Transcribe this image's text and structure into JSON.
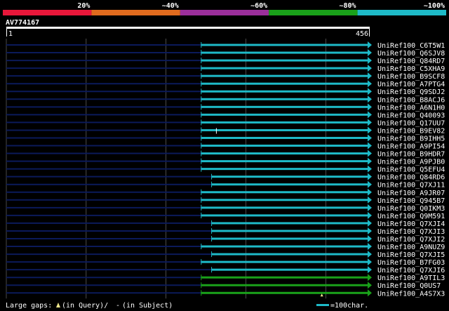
{
  "chart_data": {
    "type": "alignment",
    "query_name": "AV774167",
    "query_length": 456,
    "scale_start_label": "1",
    "scale_end_label": "456",
    "identity_scale": [
      {
        "label": "20%",
        "color": "#e8173a"
      },
      {
        "label": "~40%",
        "color": "#e06b1e"
      },
      {
        "label": "~60%",
        "color": "#9b2f9b"
      },
      {
        "label": "~80%",
        "color": "#1aa11a"
      },
      {
        "label": "~100%",
        "color": "#1ebac8"
      }
    ],
    "hits": [
      {
        "name": "UniRef100_C6T5W1",
        "start": 245,
        "end": 456,
        "color": "#1ebac8"
      },
      {
        "name": "UniRef100_Q6SJV8",
        "start": 245,
        "end": 456,
        "color": "#1ebac8"
      },
      {
        "name": "UniRef100_Q84RD7",
        "start": 245,
        "end": 456,
        "color": "#1ebac8"
      },
      {
        "name": "UniRef100_C5XHA9",
        "start": 245,
        "end": 456,
        "color": "#1ebac8"
      },
      {
        "name": "UniRef100_B9SCF8",
        "start": 245,
        "end": 456,
        "color": "#1ebac8"
      },
      {
        "name": "UniRef100_A7PTG4",
        "start": 245,
        "end": 456,
        "color": "#1ebac8"
      },
      {
        "name": "UniRef100_Q9SDJ2",
        "start": 245,
        "end": 456,
        "color": "#1ebac8"
      },
      {
        "name": "UniRef100_B8ACJ6",
        "start": 245,
        "end": 456,
        "color": "#1ebac8"
      },
      {
        "name": "UniRef100_A6N1H0",
        "start": 245,
        "end": 456,
        "color": "#1ebac8"
      },
      {
        "name": "UniRef100_Q40093",
        "start": 245,
        "end": 456,
        "color": "#1ebac8"
      },
      {
        "name": "UniRef100_Q17UU7",
        "start": 245,
        "end": 456,
        "color": "#1ebac8"
      },
      {
        "name": "UniRef100_B9EV82",
        "start": 245,
        "end": 456,
        "color": "#1ebac8",
        "subject_gap_at": 264
      },
      {
        "name": "UniRef100_B9IHH5",
        "start": 245,
        "end": 456,
        "color": "#1ebac8"
      },
      {
        "name": "UniRef100_A9PI54",
        "start": 245,
        "end": 456,
        "color": "#1ebac8"
      },
      {
        "name": "UniRef100_B9HDR7",
        "start": 245,
        "end": 456,
        "color": "#1ebac8"
      },
      {
        "name": "UniRef100_A9PJB0",
        "start": 245,
        "end": 456,
        "color": "#1ebac8"
      },
      {
        "name": "UniRef100_Q5EFU4",
        "start": 245,
        "end": 456,
        "color": "#1ebac8"
      },
      {
        "name": "UniRef100_Q84RD6",
        "start": 258,
        "end": 456,
        "color": "#1ebac8"
      },
      {
        "name": "UniRef100_Q7XJ11",
        "start": 258,
        "end": 456,
        "color": "#1ebac8"
      },
      {
        "name": "UniRef100_A9JR07",
        "start": 245,
        "end": 456,
        "color": "#1ebac8"
      },
      {
        "name": "UniRef100_Q945B7",
        "start": 245,
        "end": 456,
        "color": "#1ebac8"
      },
      {
        "name": "UniRef100_Q0IKM3",
        "start": 245,
        "end": 456,
        "color": "#1ebac8"
      },
      {
        "name": "UniRef100_Q9M591",
        "start": 245,
        "end": 456,
        "color": "#1ebac8"
      },
      {
        "name": "UniRef100_Q7XJI4",
        "start": 258,
        "end": 456,
        "color": "#1ebac8"
      },
      {
        "name": "UniRef100_Q7XJI3",
        "start": 258,
        "end": 456,
        "color": "#1ebac8"
      },
      {
        "name": "UniRef100_Q7XJI2",
        "start": 258,
        "end": 456,
        "color": "#1ebac8"
      },
      {
        "name": "UniRef100_A9NUZ9",
        "start": 245,
        "end": 456,
        "color": "#1ebac8"
      },
      {
        "name": "UniRef100_Q7XJI5",
        "start": 258,
        "end": 456,
        "color": "#1ebac8"
      },
      {
        "name": "UniRef100_B7FG03",
        "start": 245,
        "end": 456,
        "color": "#1ebac8"
      },
      {
        "name": "UniRef100_Q7XJI6",
        "start": 258,
        "end": 456,
        "color": "#1ebac8"
      },
      {
        "name": "UniRef100_A9TIL3",
        "start": 245,
        "end": 456,
        "color": "#1aa11a"
      },
      {
        "name": "UniRef100_Q0US7",
        "start": 245,
        "end": 456,
        "color": "#1aa11a"
      },
      {
        "name": "UniRef100_A4S7X3",
        "start": 245,
        "end": 456,
        "color": "#1aa11a",
        "query_gap_at": 396
      }
    ],
    "legend": {
      "large_gaps_label": "Large gaps:",
      "query_gap_text": "(in Query)/",
      "subject_gap_symbol": "-",
      "subject_gap_text": "(in Subject)",
      "scale_label": "=100char."
    }
  }
}
